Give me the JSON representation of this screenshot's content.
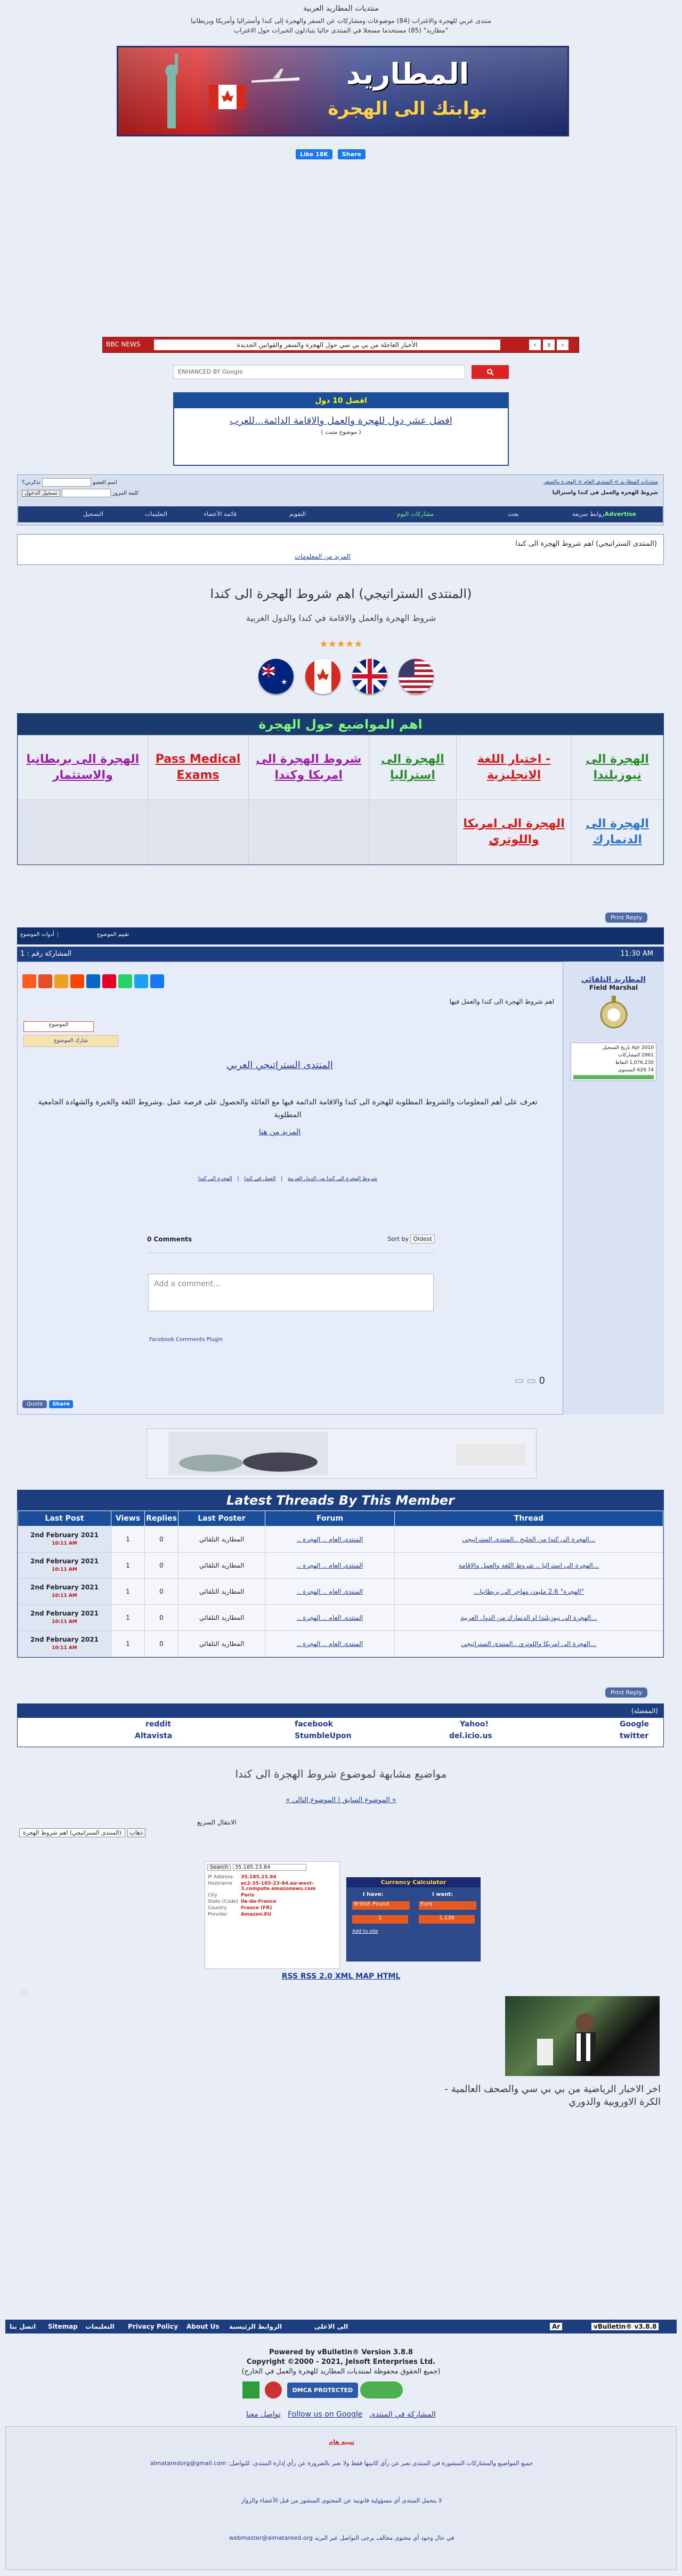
{
  "header": {
    "site_title": "ﻣﻨﺘﺪﻳﺎﺕ ﺍﻟﻤﻄﺎﺭﻳﺪ ﺍﻟﻌﺮﺑﻴﺔ",
    "description_line1": "ﻣﻨﺘﺪﻯ ﻋﺮﺑﻲ ﻟﻠﻬﺠﺮﺓ ﻭﺍﻻﻏﺘﺮﺍﺏ (84) ﻣﻮﺿﻮﻋﺎﺕ ﻭﻣﺸﺎﺭﻛﺎﺕ ﻋﻦ ﺍﻟﺴﻔﺮ ﻭﺍﻟﻬﺠﺮﺓ ﺇﻟﻰ ﻛﻨﺪﺍ ﻭﺃﺳﺘﺮﺍﻟﻴﺎ ﻭﺃﻣﺮﻳﻜﺎ ﻭﺑﺮﻳﻄﺎﻧﻴﺎ",
    "description_line2": "\"ﻣﻄﺎﺭﻳﺪ\" (85) ﻣﺴﺘﺨﺪﻣﺎ ﻣﺴﺠﻼ ﻓﻲ ﺍﻟﻤﻨﺘﺪﻯ ﺣﺎﻟﻴﺎ ﻳﺘﺒﺎﺩﻟﻮﻥ ﺍﻟﺨﺒﺮﺍﺕ ﺣﻮﻝ ﺍﻻﻏﺘﺮﺍﺏ",
    "logo_text": "ﺍﻟﻤﻄﺎﺭﻳﺪ",
    "slogan": "ﺑﻮﺍﺑﺘﻚ ﺍﻟﻰ ﺍﻟﻬﺠﺮﺓ",
    "like_label": "Like 18K",
    "share_label": "Share"
  },
  "ticker": {
    "label": "BBC NEWS",
    "headline": "ﺍﻷﺧﺒﺎﺭ ﺍﻟﻌﺎﺟﻠﺔ ﻣﻦ ﺑﻲ ﺑﻲ ﺳﻲ ﺣﻮﻝ ﺍﻟﻬﺠﺮﺓ ﻭﺍﻟﺴﻔﺮ ﻭﺍﻟﻘﻮﺍﻧﻴﻦ ﺍﻟﺠﺪﻳﺪﺓ"
  },
  "search": {
    "placeholder": "ENHANCED BY Google"
  },
  "top10": {
    "header": "ﺍﻓﻀﻞ 10 ﺩﻭﻝ",
    "headline": "ﺍﻓﻀﻞ ﻋﺸﺮ ﺩﻭﻝ ﻟﻠﻬﺠﺮﺓ ﻭﺍﻟﻌﻤﻞ ﻭﺍﻻﻗﺎﻣﺔ ﺍﻟﺪﺍﺋﻤﺔ...ﻟﻠﻌﺮﺏ",
    "sub": "( ﻣﻮﺿﻮﻉ ﻣﺜﺒﺖ )"
  },
  "nav": {
    "breadcrumb": "ﻣﻨﺘﺪﻳﺎﺕ ﺍﻟﻤﻄﺎﺭﻳﺪ > ﺍﻟﻤﻨﺘﺪﻯ ﺍﻟﻌﺎﻡ > ﺍﻟﻬﺠﺮﺓ ﻭﺍﻟﺴﻔﺮ",
    "thread_short": "ﺷﺮﻭﻁ ﺍﻟﻬﺠﺮﺓ ﻭﺍﻟﻌﻤﻞ ﻓﻲ ﻛﻨﺪﺍ ﻭﺍﺳﺘﺮﺍﻟﻴﺎ",
    "username_label": "ﺍﺳﻢ ﺍﻟﻌﻀﻮ",
    "password_label": "ﻛﻠﻤﺔ ﺍﻟﻤﺮﻭﺭ",
    "remember_label": "ﺗﺬﻛﺮﻧﻲ؟",
    "login_button": "ﺗﺴﺠﻴﻞ ﺍﻟﺪﺧﻮﻝ",
    "items": [
      "ﺍﻟﺘﺴﺠﻴﻞ",
      "ﺍﻟﺘﻌﻠﻴﻤﺎﺕ",
      "ﻗﺎﺋﻤﺔ ﺍﻷﻋﻀﺎﺀ",
      "ﺍﻟﺘﻘﻮﻳﻢ",
      "ﻣﺸﺎﺭﻛﺎﺕ ﺍﻟﻴﻮﻡ",
      "ﺑﺤﺚ",
      "ﺭﻭﺍﺑﻂ ﺳﺮﻳﻌﺔ",
      "Advertise"
    ]
  },
  "notice": {
    "line1": "(ﺍﻟﻤﻨﺘﺪﻯ ﺍﻟﺴﺘﺮﺍﺗﻴﺠﻲ) ﺍﻫﻢ ﺷﺮﻭﻁ ﺍﻟﻬﺠﺮﺓ ﺍﻟﻰ ﻛﻨﺪﺍ",
    "line2": "ﺍﻟﻤﺰﻳﺪ ﻣﻦ ﺍﻟﻤﻌﻠﻮﻣﺎﺕ"
  },
  "page": {
    "title": "(ﺍﻟﻤﻨﺘﺪﻯ ﺍﻟﺴﺘﺮﺍﺗﻴﺠﻲ) ﺍﻫﻢ ﺷﺮﻭﻁ ﺍﻟﻬﺠﺮﺓ ﺍﻟﻰ ﻛﻨﺪﺍ",
    "subtitle": "ﺷﺮﻭﻁ ﺍﻟﻬﺠﺮﺓ ﻭﺍﻟﻌﻤﻞ ﻭﺍﻻﻗﺎﻣﺔ ﻓﻲ ﻛﻨﺪﺍ ﻭﺍﻟﺪﻭﻝ ﺍﻟﻐﺮﺑﻴﺔ",
    "rating": "★★★★★"
  },
  "links_table": {
    "header": "ﺍﻫﻢ ﺍﻟﻤﻮﺍﺿﻴﻊ ﺣﻮﻝ ﺍﻟﻬﺠﺮﺓ",
    "row1": [
      {
        "text": "ﺍﻟﻬﺠﺮﺓ ﺍﻟﻰ ﻧﻴﻮﺯﻳﻠﻨﺪﺍ",
        "color": "#2b8a2b"
      },
      {
        "text": "- ﺍﺧﺘﺒﺎﺭ ﺍﻟﻠﻐﺔ ﺍﻻﻧﺠﻠﻴﺰﻳﺔ",
        "color": "#d41b1b"
      },
      {
        "text": "ﺍﻟﻬﺠﺮﺓ ﺍﻟﻰ ﺍﺳﺘﺮﺍﻟﻴﺎ",
        "color": "#2b8a2b"
      },
      {
        "text": "ﺷﺮﻭﻁ ﺍﻟﻬﺠﺮﺓ ﺍﻟﻰ ﺍﻣﺮﻳﻜﺎ ﻭﻛﻨﺪﺍ",
        "color": "#9b1fa3"
      },
      {
        "text": "Pass Medical Exams",
        "color": "#d41b1b"
      },
      {
        "text": "ﺍﻟﻬﺠﺮﺓ ﺍﻟﻰ ﺑﺮﻳﻄﺎﻧﻴﺎ ﻭﺍﻻﺳﺘﺜﻤﺎﺭ",
        "color": "#9b1fa3"
      }
    ],
    "row2": [
      {
        "text": "ﺍﻟﻬﺠﺮﺓ ﺍﻟﻰ ﺍﻟﺪﻧﻤﺎﺭﻙ",
        "color": "#2f74c9"
      },
      {
        "text": "ﺍﻟﻬﺠﺮﺓ ﺍﻟﻰ ﺍﻣﺮﻳﻜﺎ ﻭﺍﻟﻠﻮﺗﺮﻱ",
        "color": "#d41b1b"
      }
    ]
  },
  "post": {
    "print_label": "Print Reply",
    "tools": [
      "ﺃﺩﻭﺍﺕ ﺍﻟﻤﻮﺿﻮﻉ",
      "ﺗﻘﻴﻴﻢ ﺍﻟﻤﻮﺿﻮﻉ"
    ],
    "number": "1 : ﺍﻟﻤﺸﺎﺭﻛﺔ ﺭﻗﻢ",
    "time": "11:30 AM",
    "author": "ﺍﻟﻤﻄﺎﺭﻳﺪ ﺍﻟﺘﻠﻘﺎﺋﻲ",
    "rank": "Field Marshal",
    "join_date": "Apr 2010 ﺗﺎﺭﻳﺦ ﺍﻟﺘﺴﺠﻴﻞ",
    "posts": "2861 ﺍﻟﻤﺸﺎﺭﻛﺎﺕ",
    "points": "1,076,230 ﺍﻟﻨﻘﺎﻁ",
    "level": "629.74 ﺍﻟﻤﺴﺘﻮﻯ",
    "post_title": "ﺍﻫﻢ ﺷﺮﻭﻁ ﺍﻟﻬﺠﺮﺓ ﺍﻟﻰ ﻛﻨﺪﺍ ﻭﺍﻟﻌﻤﻞ ﻓﻴﻬﺎ",
    "mini_tag": "ﺍﻟﻤﻮﺿﻮﻉ",
    "mini_tag2": "ﺷﺎﺭﻙ ﺍﻟﻤﻮﺿﻮﻉ",
    "link_heading": "ﺍﻟﻤﻨﺘﺪﻯ ﺍﻟﺴﺘﺮﺍﺗﻴﺠﻲ ﺍﻟﻌﺮﺑﻲ",
    "body": "ﺗﻌﺮﻑ ﻋﻠﻰ ﺃﻫﻢ ﺍﻟﻤﻌﻠﻮﻣﺎﺕ ﻭﺍﻟﺸﺮﻭﻁ ﺍﻟﻤﻄﻠﻮﺑﺔ ﻟﻠﻬﺠﺮﺓ ﺍﻟﻰ ﻛﻨﺪﺍ ﻭﺍﻻﻗﺎﻣﺔ ﺍﻟﺪﺍﺋﻤﺔ ﻓﻴﻬﺎ ﻣﻊ ﺍﻟﻌﺎﺋﻠﺔ ﻭﺍﻟﺤﺼﻮﻝ ﻋﻠﻰ ﻓﺮﺻﺔ ﻋﻤﻞ .ﻭﺷﺮﻭﻁ ﺍﻟﻠﻐﺔ ﻭﺍﻟﺨﺒﺮﺓ ﻭﺍﻟﺸﻬﺎﺩﺓ ﺍﻟﺠﺎﻣﻌﻴﺔ ﺍﻟﻤﻄﻠﻮﺑﺔ",
    "read_more": "ﺍﻟﻤﺰﻳﺪ ﻣﻦ ﻫﻨﺎ",
    "related": [
      "ﺍﻟﻬﺠﺮﺓ ﺍﻟﻰ ﻛﻨﺪﺍ",
      "ﺍﻟﻌﻤﻞ ﻓﻲ ﻛﻨﺪﺍ",
      "ﺷﺮﻭﻁ ﺍﻟﻬﺠﺮﺓ ﺍﻟﻰ ﻛﻨﺪﺍ ﻣﻦ ﺍﻟﺪﻭﻝ ﺍﻟﻌﺮﺑﻴﺔ"
    ],
    "comments_count": "0 Comments",
    "sort_label": "Sort by",
    "sort_value": "Oldest",
    "comment_placeholder": "Add a comment...",
    "fb_plugin": "Facebook Comments Plugin",
    "quote_label": "Quote",
    "share_label": "Share",
    "count": "0"
  },
  "latest": {
    "title": "Latest Threads By This Member",
    "columns": [
      "Last Post",
      "Views",
      "Replies",
      "Last Poster",
      "Forum",
      "Thread"
    ],
    "rows": [
      {
        "date": "2nd February 2021",
        "time": "10:11 AM",
        "views": "1",
        "replies": "0",
        "poster": "ﺍﻟﻤﻄﺎﺭﻳﺪ ﺍﻟﺘﻠﻘﺎﺋﻲ",
        "forum": "ﺍﻟﻤﻨﺘﺪﻯ ﺍﻟﻌﺎﻡ .. ﺍﻟﻬﺠﺮﺓ ..",
        "thread": "...ﺍﻟﻬﺠﺮﺓ ﺍﻟﻰ ﻛﻨﺪﺍ ﻣﻦ ﺍﻟﺨﻠﻴﺞ ..ﺍﻟﻤﻨﺘﺪﻯ ﺍﻟﺴﺘﺮﺍﺗﻴﺠﻲ"
      },
      {
        "date": "2nd February 2021",
        "time": "10:11 AM",
        "views": "1",
        "replies": "0",
        "poster": "ﺍﻟﻤﻄﺎﺭﻳﺪ ﺍﻟﺘﻠﻘﺎﺋﻲ",
        "forum": "ﺍﻟﻤﻨﺘﺪﻯ ﺍﻟﻌﺎﻡ .. ﺍﻟﻬﺠﺮﺓ ..",
        "thread": "...ﺍﻟﻬﺠﺮﺓ ﺍﻟﻰ ﺍﺳﺘﺮﺍﻟﻴﺎ .. ﺷﺮﻭﻁ ﺍﻟﻠﻐﺔ ﻭﺍﻟﻌﻤﻞ ﻭﺍﻻﻗﺎﻣﺔ"
      },
      {
        "date": "2nd February 2021",
        "time": "10:11 AM",
        "views": "1",
        "replies": "0",
        "poster": "ﺍﻟﻤﻄﺎﺭﻳﺪ ﺍﻟﺘﻠﻘﺎﺋﻲ",
        "forum": "ﺍﻟﻤﻨﺘﺪﻯ ﺍﻟﻌﺎﻡ .. ﺍﻟﻬﺠﺮﺓ ..",
        "thread": "\"ﺍﻟﻬﺠﺮﺓ\" 2.6 ﻣﻠﻴﻮﻥ ﻣﻬﺎﺟﺮ ﺍﻟﻰ ﺑﺮﻳﻄﺎﻧﻴﺎ..."
      },
      {
        "date": "2nd February 2021",
        "time": "10:11 AM",
        "views": "1",
        "replies": "0",
        "poster": "ﺍﻟﻤﻄﺎﺭﻳﺪ ﺍﻟﺘﻠﻘﺎﺋﻲ",
        "forum": "ﺍﻟﻤﻨﺘﺪﻯ ﺍﻟﻌﺎﻡ .. ﺍﻟﻬﺠﺮﺓ ..",
        "thread": "...ﺍﻟﻬﺠﺮﺓ ﺍﻟﻰ ﻧﻴﻮﺯﻳﻠﻨﺪﺍ ﺍﻭ ﺍﻟﺪﻧﻤﺎﺭﻙ ﻣﻦ ﺍﻟﺪﻭﻝ ﺍﻟﻌﺮﺑﻴﺔ"
      },
      {
        "date": "2nd February 2021",
        "time": "10:11 AM",
        "views": "1",
        "replies": "0",
        "poster": "ﺍﻟﻤﻄﺎﺭﻳﺪ ﺍﻟﺘﻠﻘﺎﺋﻲ",
        "forum": "ﺍﻟﻤﻨﺘﺪﻯ ﺍﻟﻌﺎﻡ .. ﺍﻟﻬﺠﺮﺓ ..",
        "thread": "...ﺍﻟﻬﺠﺮﺓ ﺍﻟﻰ ﺍﻣﺮﻳﻜﺎ ﻭﺍﻟﻠﻮﺗﺮﻱ ..ﺍﻟﻤﻨﺘﺪﻯ ﺍﻟﺴﺘﺮﺍﺗﻴﺠﻲ"
      }
    ]
  },
  "bookmarks": {
    "header": "(ﺍﻟﻤﻔﻀﻠﺔ)",
    "items": [
      "Google",
      "Yahoo!",
      "facebook",
      "reddit",
      "twitter",
      "del.icio.us",
      "StumbleUpon",
      "Altavista"
    ]
  },
  "similar": {
    "title": "ﻣﻮﺍﺿﻴﻊ ﻣﺸﺎﺑﻬﺔ ﻟﻤﻮﺿﻮﻉ ﺷﺮﻭﻁ ﺍﻟﻬﺠﺮﺓ ﺍﻟﻰ ﻛﻨﺪﺍ",
    "pager": "« ﺍﻟﻤﻮﺿﻮﻉ ﺍﻟﺴﺎﺑﻖ | ﺍﻟﻤﻮﺿﻮﻉ ﺍﻟﺘﺎﻟﻲ »",
    "jump_label": "ﺍﻻﻧﺘﻘﺎﻝ ﺍﻟﺴﺮﻳﻊ",
    "jump_value": "(ﺍﻟﻤﻨﺘﺪﻯ ﺍﻟﺴﺘﺮﺍﺗﻴﺠﻲ) ﺍﻫﻢ ﺷﺮﻭﻁ ﺍﻟﻬﺠﺮﺓ",
    "go": "ﺫﻫﺎﺏ"
  },
  "ip": {
    "search": "Search",
    "ip": "35.185.23.84",
    "rows": [
      [
        "IP Address",
        "35.185.23.84"
      ],
      [
        "Hostname",
        "ec2-35-185-23-84.eu-west-3.compute.amazonaws.com"
      ],
      [
        "City",
        "Paris"
      ],
      [
        "State (Code)",
        "Ile-de-France"
      ],
      [
        "Country",
        "France (FR)"
      ],
      [
        "Provider",
        "Amazon.EU"
      ]
    ]
  },
  "currency": {
    "title": "Currency Calculator",
    "have": "I have:",
    "want": "I want:",
    "from": "British Pound",
    "to": "Euro",
    "amount": "1",
    "result": "1.136",
    "add": "Add to site"
  },
  "rss": "RSS RSS 2.0 XML MAP HTML",
  "photo_caption": "ﺍﺧﺮ ﺍﻻﺧﺒﺎﺭ ﺍﻟﺮﻳﺎﺿﻴﺔ ﻣﻦ ﺑﻲ ﺑﻲ ﺳﻲ ﻭﺍﻟﺼﺤﻒ ﺍﻟﻌﺎﻟﻤﻴﺔ - ﺍﻟﻜﺮﺓ ﺍﻻﻭﺭﻭﺑﻴﺔ ﻭﺍﻟﺪﻭﺭﻱ",
  "footer": {
    "links": [
      "ﺍﺗﺼﻞ ﺑﻨﺎ",
      "Sitemap",
      "ﺍﻟﺘﻌﻠﻴﻤﺎﺕ",
      "Privacy Policy",
      "About Us",
      "ﺍﻟﺮﻭﺍﺑﻂ ﺍﻟﺮﺋﻴﺴﻴﺔ",
      "ﺍﻟﻰ ﺍﻻﻋﻠﻰ"
    ],
    "lang": "Ar",
    "version": "vBulletin® v3.8.8",
    "powered1": "Powered by vBulletin® Version 3.8.8",
    "powered2": "Copyright ©2000 - 2021, Jelsoft Enterprises Ltd.",
    "powered3": "(ﺟﻤﻴﻊ ﺍﻟﺤﻘﻮﻕ ﻣﺤﻔﻮﻇﺔ ﻟﻤﻨﺘﺪﻳﺎﺕ ﺍﻟﻤﻄﺎﺭﻳﺪ ﻟﻠﻬﺠﺮﺓ ﻭﺍﻟﻌﻤﻞ ﻓﻲ ﺍﻟﺨﺎﺭﺝ)",
    "dmca": "DMCA PROTECTED",
    "links2": [
      "ﺍﻟﻤﺸﺎﺭﻛﺔ ﻓﻲ ﺍﻟﻤﻨﺘﺪﻯ",
      "Follow us on Google",
      "ﺗﻮﺍﺻﻞ ﻣﻌﻨﺎ"
    ],
    "disclaimer_title": "ﺗﻨﺒﻴﻪ ﻫﺎﻡ",
    "disclaimer1": "ﺟﻤﻴﻊ ﺍﻟﻤﻮﺍﺿﻴﻊ ﻭﺍﻟﻤﺸﺎﺭﻛﺎﺕ ﺍﻟﻤﻨﺸﻮﺭﺓ ﻓﻲ ﺍﻟﻤﻨﺘﺪﻯ ﺗﻌﺒﺮ ﻋﻦ ﺭﺃﻱ ﻛﺎﺗﺒﻴﻬﺎ ﻓﻘﻂ ﻭﻻ ﺗﻌﺒﺮ ﺑﺎﻟﻀﺮﻭﺭﺓ ﻋﻦ ﺭﺃﻱ ﺇﺩﺍﺭﺓ ﺍﻟﻤﻨﺘﺪﻯ. ﻟﻠﺘﻮﺍﺻﻞ: almataredorg@gmail.com",
    "disclaimer2": "ﻻ ﻳﺘﺤﻤﻞ ﺍﻟﻤﻨﺘﺪﻯ ﺃﻱ ﻣﺴﺆﻭﻟﻴﺔ ﻗﺎﻧﻮﻧﻴﺔ ﻋﻦ ﺍﻟﻤﺤﺘﻮﻯ ﺍﻟﻤﻨﺸﻮﺭ ﻣﻦ ﻗﺒﻞ ﺍﻷﻋﻀﺎﺀ ﻭﺍﻟﺰﻭﺍﺭ",
    "disclaimer3": "ﻓﻲ ﺣﺎﻝ ﻭﺟﻮﺩ ﺃﻱ ﻣﺤﺘﻮﻯ ﻣﺨﺎﻟﻒ ﻳﺮﺟﻰ ﺍﻟﺘﻮﺍﺻﻞ ﻋﺒﺮ ﺍﻟﺒﺮﻳﺪ webmaster@almatareed.org"
  }
}
